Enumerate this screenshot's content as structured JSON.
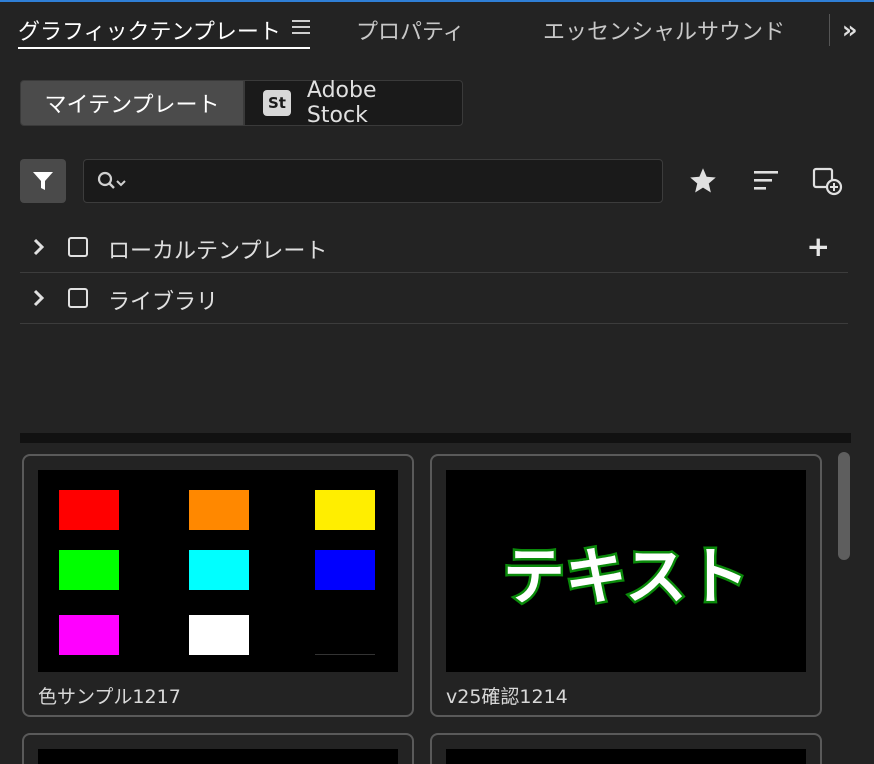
{
  "tabs": [
    {
      "label": "グラフィックテンプレート"
    },
    {
      "label": "プロパティ"
    },
    {
      "label": "エッセンシャルサウンド"
    }
  ],
  "icons": {
    "panel_menu": "hamburger-icon",
    "overflow": "double-chevron-right-icon",
    "filter": "filter-funnel-icon",
    "search": "search-dropdown-icon",
    "favorites": "star-icon",
    "sort": "sort-lines-icon",
    "new_folder": "new-item-icon",
    "expand": "chevron-right-icon",
    "add": "plus-icon"
  },
  "source_tabs": {
    "my_templates": "マイテンプレート",
    "adobe_stock_icon": "St",
    "adobe_stock": "Adobe Stock"
  },
  "search": {
    "value": "",
    "placeholder": ""
  },
  "tree": [
    {
      "label": "ローカルテンプレート",
      "checked": false,
      "has_add": true
    },
    {
      "label": "ライブラリ",
      "checked": false,
      "has_add": false
    }
  ],
  "templates": [
    {
      "name": "色サンプル1217",
      "swatches": [
        "#ff0000",
        "#ff8800",
        "#ffee00",
        "#00ff00",
        "#00ffff",
        "#0000ff",
        "#ff00ff",
        "#ffffff",
        "#000000"
      ]
    },
    {
      "name": "v25確認1214",
      "preview_text": "テキスト",
      "preview_colors": {
        "fill": "#ffffff",
        "stroke": "#0a8a0a"
      }
    }
  ],
  "colors": {
    "panel_bg": "#232323",
    "accent_line": "#2f7fd6",
    "selected_segment": "#4b4b4b"
  }
}
